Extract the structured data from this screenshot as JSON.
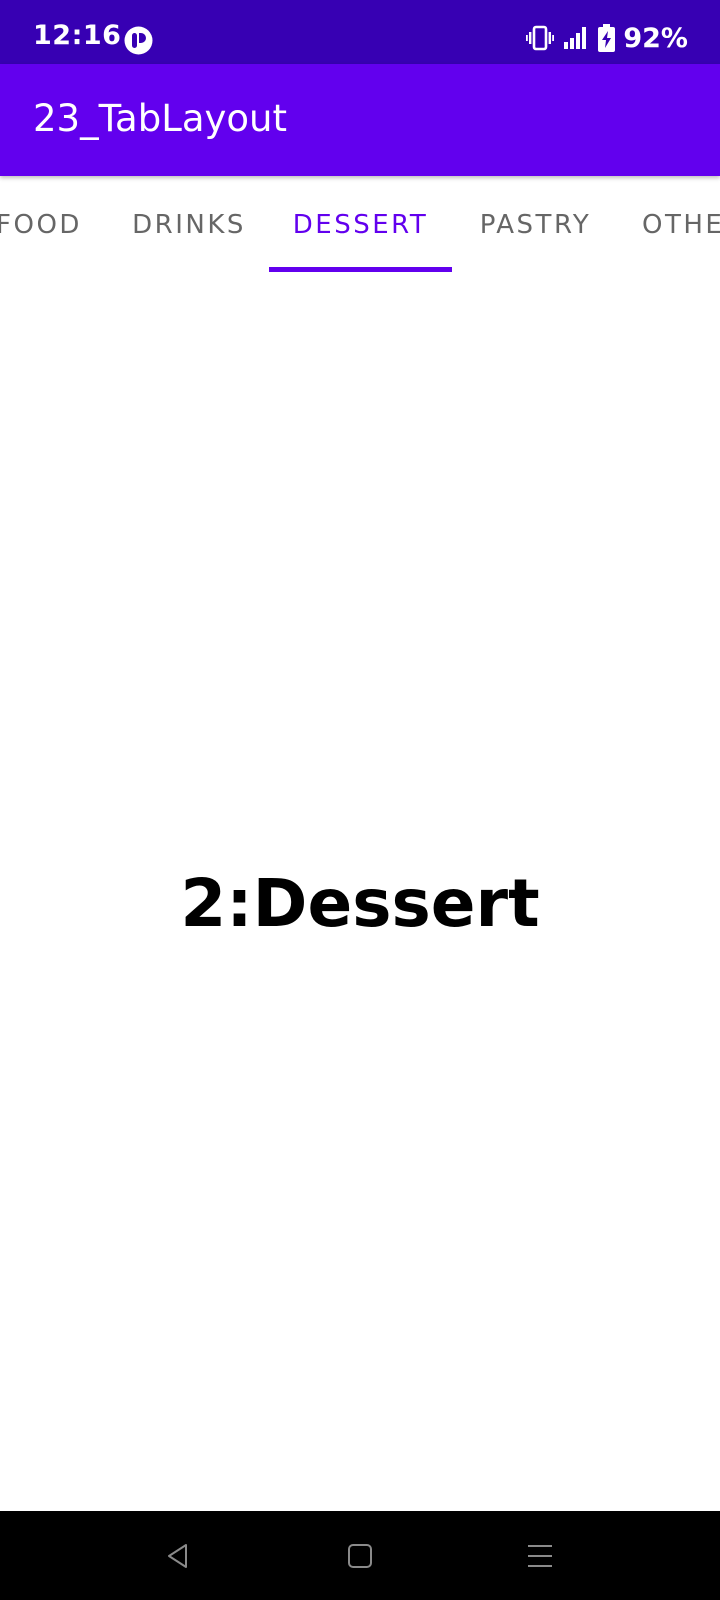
{
  "status_bar": {
    "time": "12:16",
    "battery": "92%",
    "icons": [
      "app-notification-icon",
      "vibrate-icon",
      "signal-icon",
      "battery-charging-icon"
    ]
  },
  "app_bar": {
    "title": "23_TabLayout"
  },
  "tabs": [
    {
      "label": "FOOD",
      "selected": false
    },
    {
      "label": "DRINKS",
      "selected": false
    },
    {
      "label": "DESSERT",
      "selected": true
    },
    {
      "label": "PASTRY",
      "selected": false
    },
    {
      "label": "OTHE",
      "selected": false
    }
  ],
  "content": {
    "text": "2:Dessert"
  },
  "nav_bar": {
    "buttons": [
      "back-icon",
      "home-icon",
      "recents-icon"
    ]
  },
  "colors": {
    "status_bar": "#3700B3",
    "app_bar": "#6200EE",
    "accent": "#6200EE",
    "tab_inactive": "#666666",
    "nav_bar": "#000000"
  }
}
